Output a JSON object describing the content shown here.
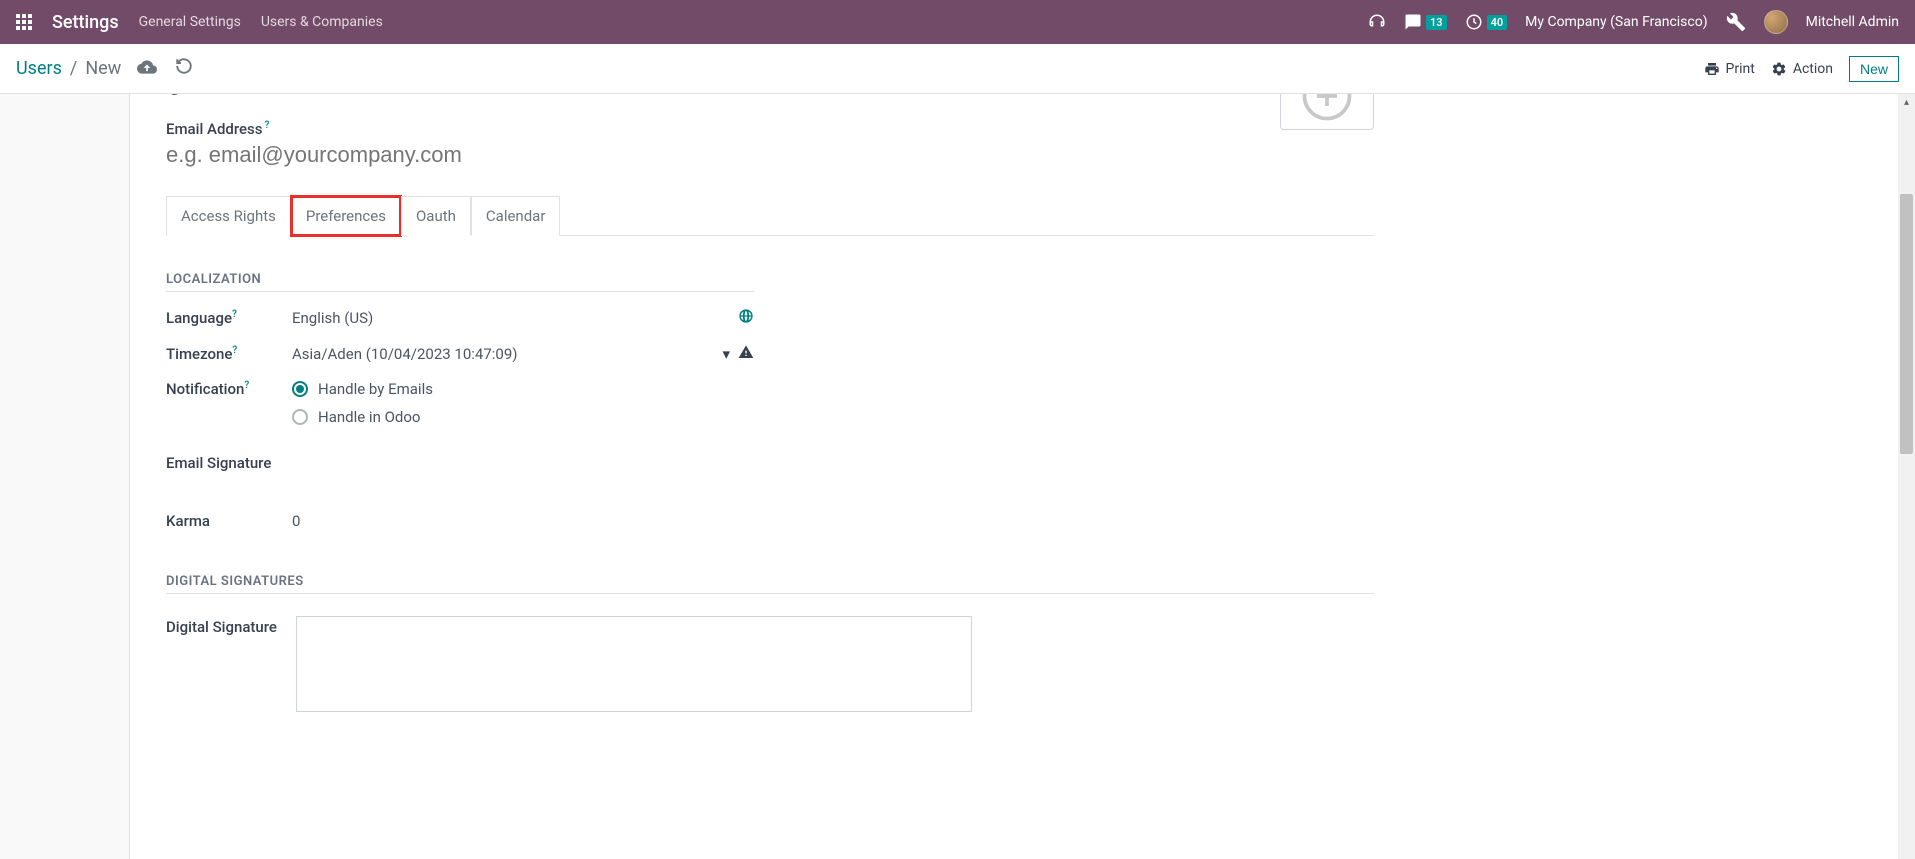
{
  "topnav": {
    "brand": "Settings",
    "menu": [
      "General Settings",
      "Users & Companies"
    ],
    "messages_badge": "13",
    "activities_badge": "40",
    "company": "My Company (San Francisco)",
    "user": "Mitchell Admin"
  },
  "control_panel": {
    "breadcrumb_root": "Users",
    "breadcrumb_current": "New",
    "print": "Print",
    "action": "Action",
    "new_btn": "New"
  },
  "form": {
    "partial_name_placeholder": "e.g. John Doe",
    "email_label": "Email Address",
    "email_placeholder": "e.g. email@yourcompany.com",
    "tabs": [
      "Access Rights",
      "Preferences",
      "Oauth",
      "Calendar"
    ],
    "active_tab_index": 1,
    "sections": {
      "localization": {
        "title": "Localization",
        "language_label": "Language",
        "language_value": "English (US)",
        "timezone_label": "Timezone",
        "timezone_value": "Asia/Aden (10/04/2023 10:47:09)",
        "notification_label": "Notification",
        "notification_options": [
          "Handle by Emails",
          "Handle in Odoo"
        ],
        "notification_selected": 0,
        "email_signature_label": "Email Signature",
        "karma_label": "Karma",
        "karma_value": "0"
      },
      "digital": {
        "title": "Digital Signatures",
        "signature_label": "Digital Signature"
      }
    }
  }
}
